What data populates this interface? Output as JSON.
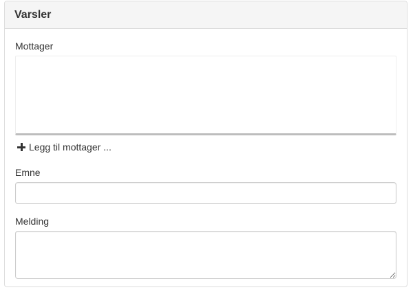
{
  "panel": {
    "title": "Varsler"
  },
  "form": {
    "recipient_label": "Mottager",
    "add_recipient_label": "Legg til mottager ...",
    "subject_label": "Emne",
    "subject_value": "",
    "message_label": "Melding",
    "message_value": ""
  },
  "icons": {
    "add": "plus-icon"
  }
}
